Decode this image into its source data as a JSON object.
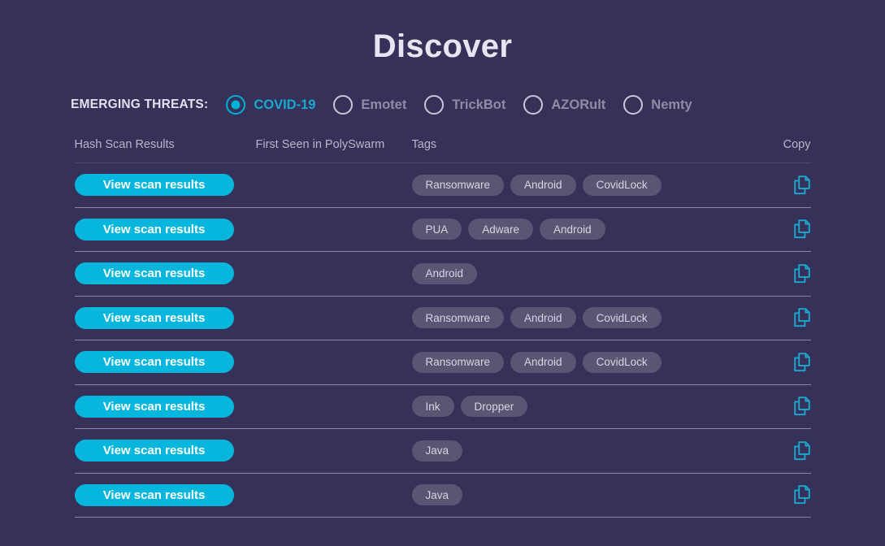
{
  "page": {
    "title": "Discover",
    "background_color": "#363158",
    "accent_color": "#06b6dd"
  },
  "emerging_threats": {
    "label": "EMERGING THREATS:",
    "options": [
      {
        "label": "COVID-19",
        "selected": true
      },
      {
        "label": "Emotet",
        "selected": false
      },
      {
        "label": "TrickBot",
        "selected": false
      },
      {
        "label": "AZORult",
        "selected": false
      },
      {
        "label": "Nemty",
        "selected": false
      }
    ]
  },
  "table": {
    "columns": {
      "hash": "Hash Scan Results",
      "first_seen": "First Seen in PolySwarm",
      "tags": "Tags",
      "copy": "Copy"
    },
    "scan_button_label": "View scan results",
    "copy_icon_name": "copy-icon",
    "rows": [
      {
        "scan_label": "View scan results",
        "first_seen": "",
        "tags": [
          "Ransomware",
          "Android",
          "CovidLock"
        ]
      },
      {
        "scan_label": "View scan results",
        "first_seen": "",
        "tags": [
          "PUA",
          "Adware",
          "Android"
        ]
      },
      {
        "scan_label": "View scan results",
        "first_seen": "",
        "tags": [
          "Android"
        ]
      },
      {
        "scan_label": "View scan results",
        "first_seen": "",
        "tags": [
          "Ransomware",
          "Android",
          "CovidLock"
        ]
      },
      {
        "scan_label": "View scan results",
        "first_seen": "",
        "tags": [
          "Ransomware",
          "Android",
          "CovidLock"
        ]
      },
      {
        "scan_label": "View scan results",
        "first_seen": "",
        "tags": [
          "Ink",
          "Dropper"
        ]
      },
      {
        "scan_label": "View scan results",
        "first_seen": "",
        "tags": [
          "Java"
        ]
      },
      {
        "scan_label": "View scan results",
        "first_seen": "",
        "tags": [
          "Java"
        ]
      }
    ]
  }
}
